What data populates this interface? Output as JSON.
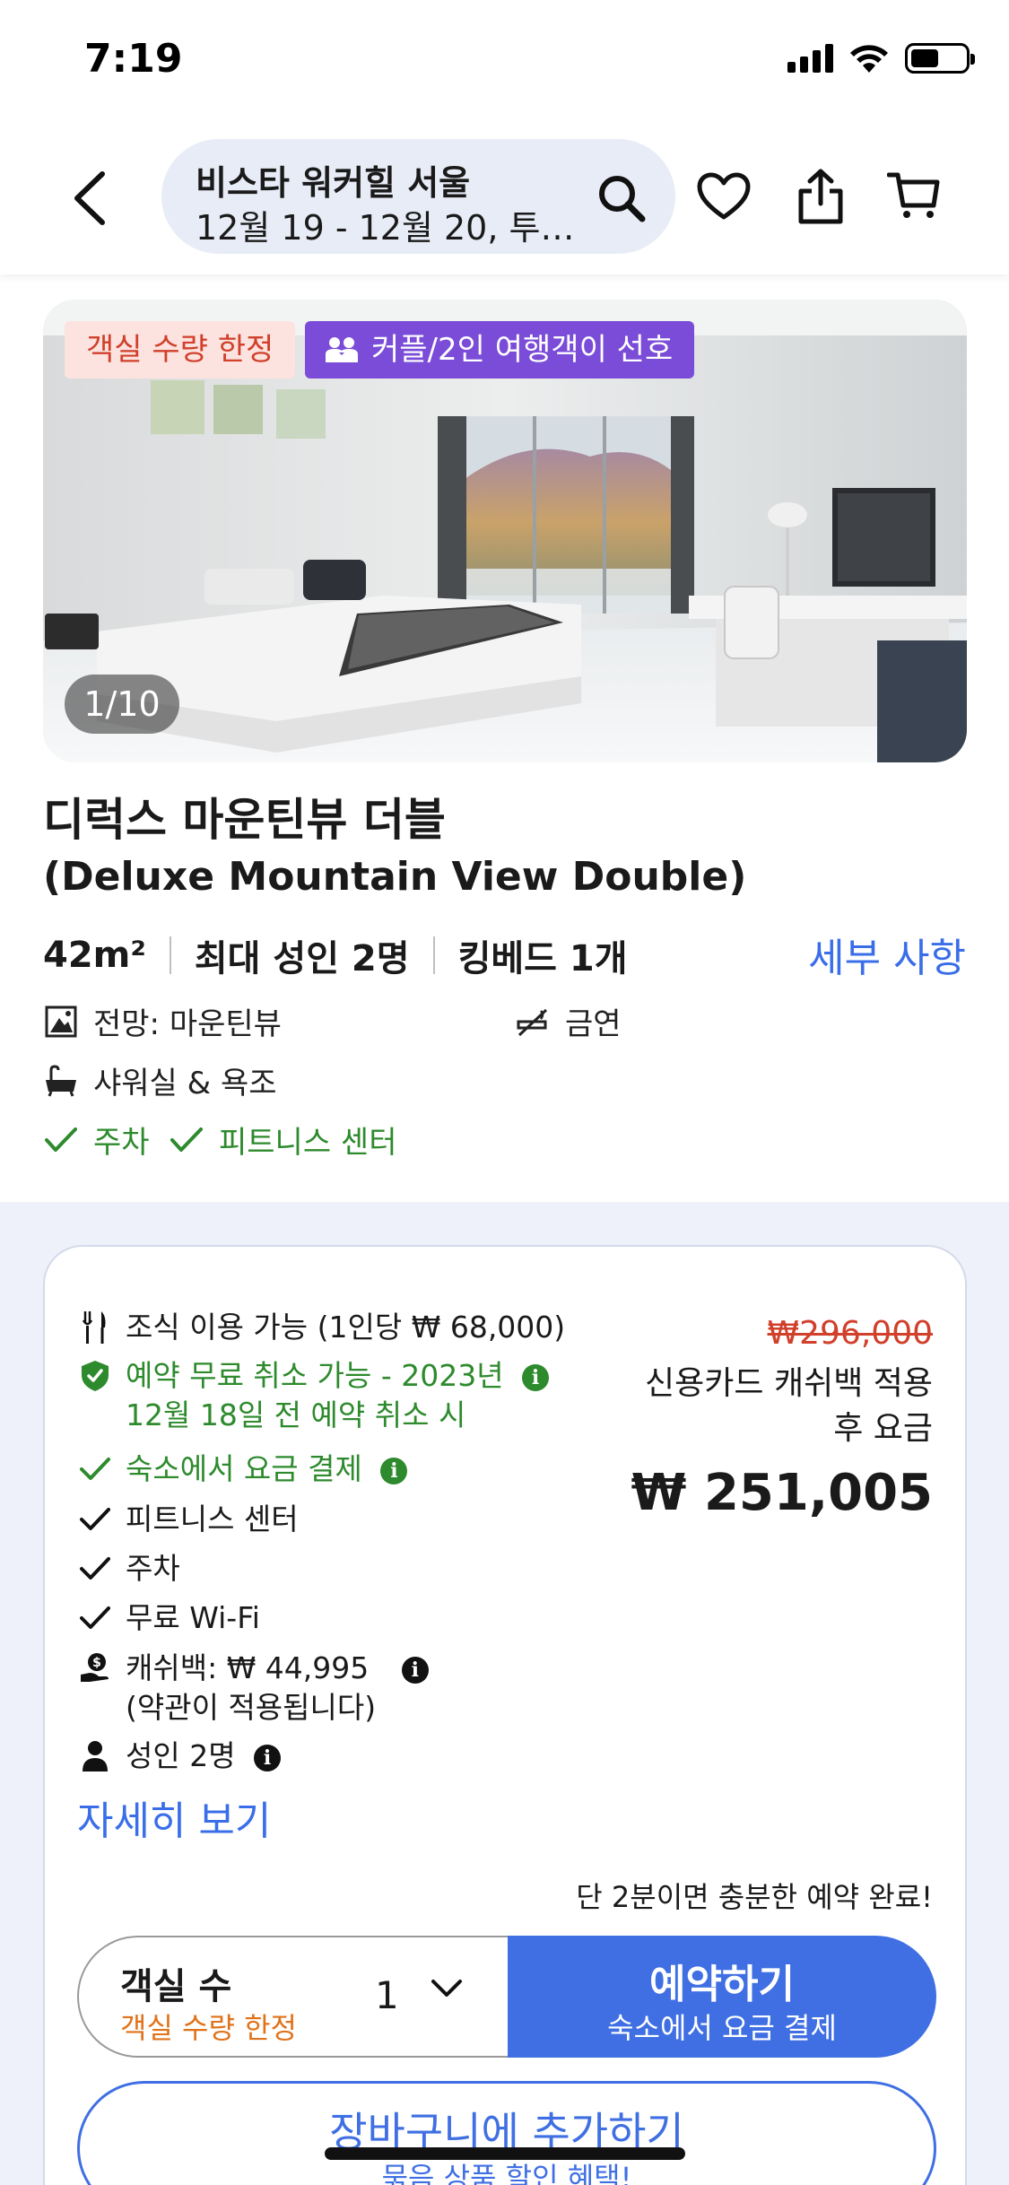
{
  "status_bar": {
    "time": "7:19"
  },
  "header": {
    "search_title": "비스타 워커힐 서울",
    "search_subtitle": "12월 19 - 12월 20, 투…"
  },
  "room": {
    "tags": {
      "limited": "객실 수량 한정",
      "couple": "커플/2인 여행객이 선호"
    },
    "photo_counter": "1/10",
    "name_ko": "디럭스 마운틴뷰 더블",
    "name_en": "(Deluxe Mountain View Double)",
    "specs": [
      "42m²",
      "최대 성인 2명",
      "킹베드 1개"
    ],
    "details_link": "세부 사항",
    "features": {
      "view": "전망: 마운틴뷰",
      "smoking": "금연",
      "bath": "샤워실 & 욕조",
      "parking": "주차",
      "fitness": "피트니스 센터"
    }
  },
  "rate": {
    "inclusions": {
      "breakfast": "조식 이용 가능 (1인당 ₩ 68,000)",
      "free_cancel_line1": "예약 무료 취소 가능 - 2023년",
      "free_cancel_line2": "12월 18일 전 예약 취소 시",
      "pay_at_hotel": "숙소에서 요금 결제",
      "fitness": "피트니스 센터",
      "parking": "주차",
      "wifi": "무료 Wi-Fi",
      "cashback_line1": "캐쉬백: ₩ 44,995",
      "cashback_line2": "(약관이 적용됩니다)",
      "adults": "성인 2명"
    },
    "old_price": "₩296,000",
    "price_note_line1": "신용카드 캐쉬백 적용",
    "price_note_line2": "후 요금",
    "final_price": "₩ 251,005",
    "more_link": "자세히 보기",
    "quick_note": "단 2분이면 충분한 예약 완료!",
    "room_count_label": "객실 수",
    "room_count_sub": "객실 수량 한정",
    "room_count_value": "1",
    "book_label": "예약하기",
    "book_sub": "숙소에서 요금 결제",
    "cart_label": "장바구니에 추가하기",
    "cart_sub": "묶음 상품 할인 혜택!"
  },
  "colors": {
    "accent_blue": "#3f6fe3",
    "green": "#2d8a2d",
    "red": "#d0402b",
    "purple_tag": "#7a4cd8",
    "orange": "#e0731a"
  }
}
